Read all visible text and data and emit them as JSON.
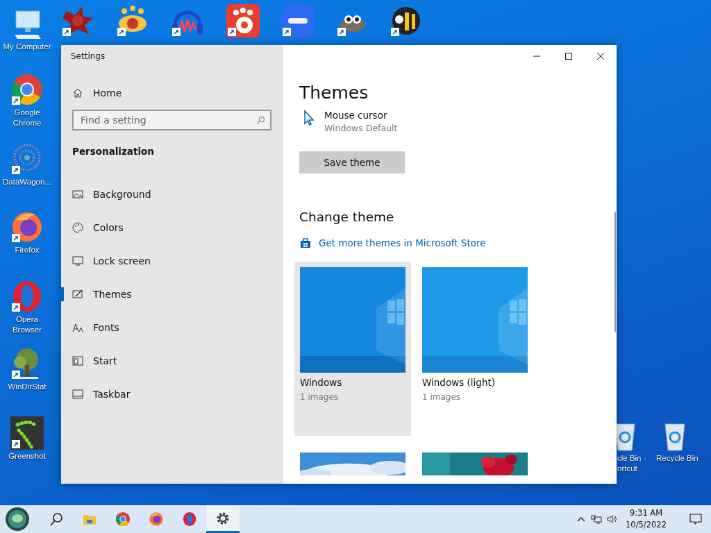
{
  "desktop": {
    "left_icons": [
      {
        "kind": "computer",
        "label": "My Computer"
      },
      {
        "kind": "chrome",
        "label": "Google Chrome"
      },
      {
        "kind": "web",
        "label": "DataWagon..."
      },
      {
        "kind": "firefox",
        "label": "Firefox"
      },
      {
        "kind": "opera",
        "label": "Opera Browser"
      },
      {
        "kind": "tree",
        "label": "WinDirStat"
      },
      {
        "kind": "dots",
        "label": "Greenshot"
      }
    ],
    "top_icons": [
      {
        "kind": "splat"
      },
      {
        "kind": "eye"
      },
      {
        "kind": "headphones"
      },
      {
        "kind": "paw"
      },
      {
        "kind": "video"
      },
      {
        "kind": "creature"
      },
      {
        "kind": "bee"
      }
    ],
    "right_icons": [
      {
        "kind": "bin",
        "label": "cle Bin - ortcut"
      },
      {
        "kind": "bin",
        "label": "Recycle Bin"
      }
    ]
  },
  "window": {
    "title": "Settings"
  },
  "sidebar": {
    "home": "Home",
    "search": {
      "placeholder": "Find a setting"
    },
    "section": "Personalization",
    "items": [
      {
        "kind": "picture",
        "label": "Background",
        "selected": false
      },
      {
        "kind": "palette",
        "label": "Colors",
        "selected": false
      },
      {
        "kind": "screen",
        "label": "Lock screen",
        "selected": false
      },
      {
        "kind": "brush",
        "label": "Themes",
        "selected": true
      },
      {
        "kind": "font",
        "label": "Fonts",
        "selected": false
      },
      {
        "kind": "start",
        "label": "Start",
        "selected": false
      },
      {
        "kind": "taskbar",
        "label": "Taskbar",
        "selected": false
      }
    ]
  },
  "content": {
    "title": "Themes",
    "cursor": {
      "name": "Mouse cursor",
      "value": "Windows Default"
    },
    "save_button": "Save theme",
    "change_heading": "Change theme",
    "store_link": "Get more themes in Microsoft Store",
    "themes": [
      {
        "kind": "windows",
        "name": "Windows",
        "count": "1 images",
        "selected": true
      },
      {
        "kind": "windows-light",
        "name": "Windows (light)",
        "count": "1 images",
        "selected": false
      },
      {
        "kind": "sky"
      },
      {
        "kind": "flower"
      }
    ]
  },
  "taskbar": {
    "apps": [
      {
        "kind": "search",
        "selected": false
      },
      {
        "kind": "folder",
        "selected": false
      },
      {
        "kind": "chrome",
        "selected": false
      },
      {
        "kind": "firefox",
        "selected": false
      },
      {
        "kind": "opera",
        "selected": false
      },
      {
        "kind": "gear",
        "selected": true
      }
    ],
    "time": "9:31 AM",
    "date": "10/5/2022"
  }
}
